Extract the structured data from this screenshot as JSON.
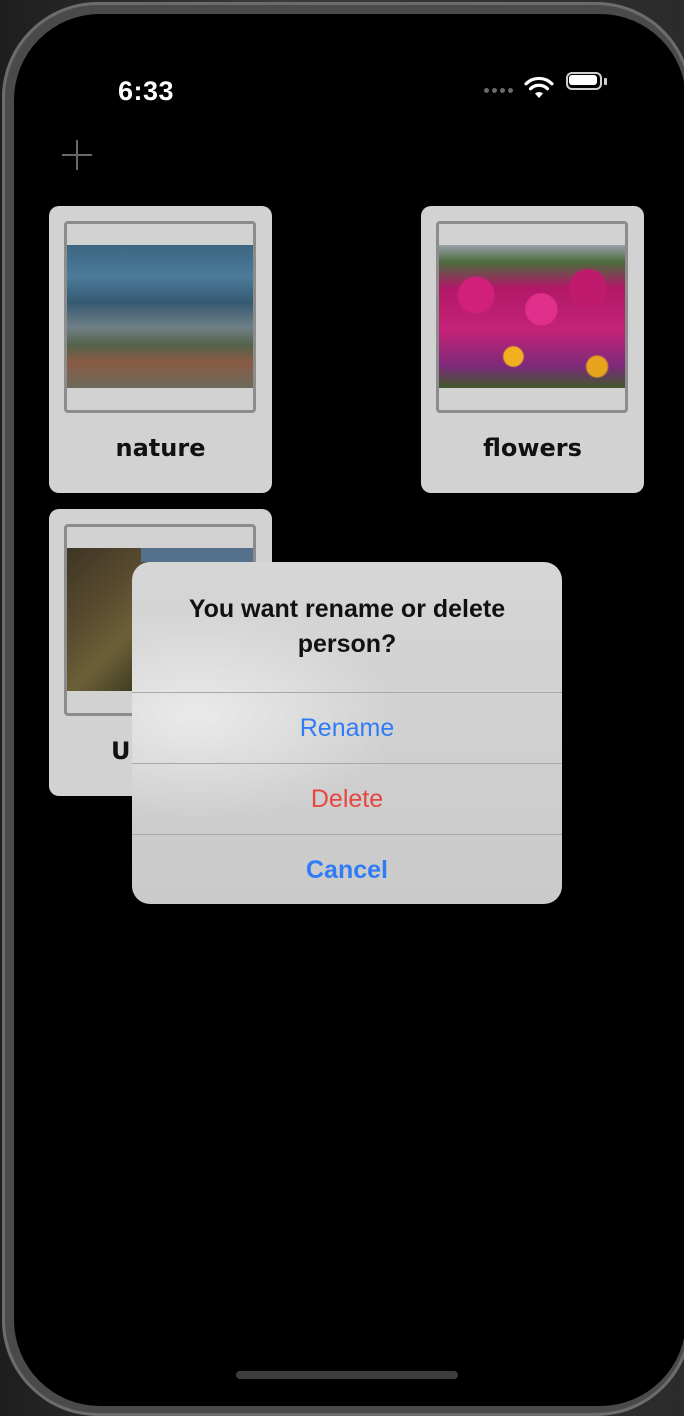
{
  "status_bar": {
    "time": "6:33",
    "icons": [
      "signal-dots-icon",
      "wifi-icon",
      "battery-icon"
    ]
  },
  "toolbar": {
    "add_icon": "plus-icon"
  },
  "albums": [
    {
      "label": "nature",
      "photo": "storm-clouds-over-field"
    },
    {
      "label": "flowers",
      "photo": "magenta-flower-bed"
    },
    {
      "label": "Ur",
      "photo": "rocky-hillside"
    }
  ],
  "dialog": {
    "title": "You want rename or delete person?",
    "buttons": {
      "rename": "Rename",
      "delete": "Delete",
      "cancel": "Cancel"
    }
  },
  "colors": {
    "action_blue": "#2f7cf6",
    "destructive_red": "#e5483e",
    "card_bg": "#d2d2d2",
    "screen_bg": "#000000"
  }
}
